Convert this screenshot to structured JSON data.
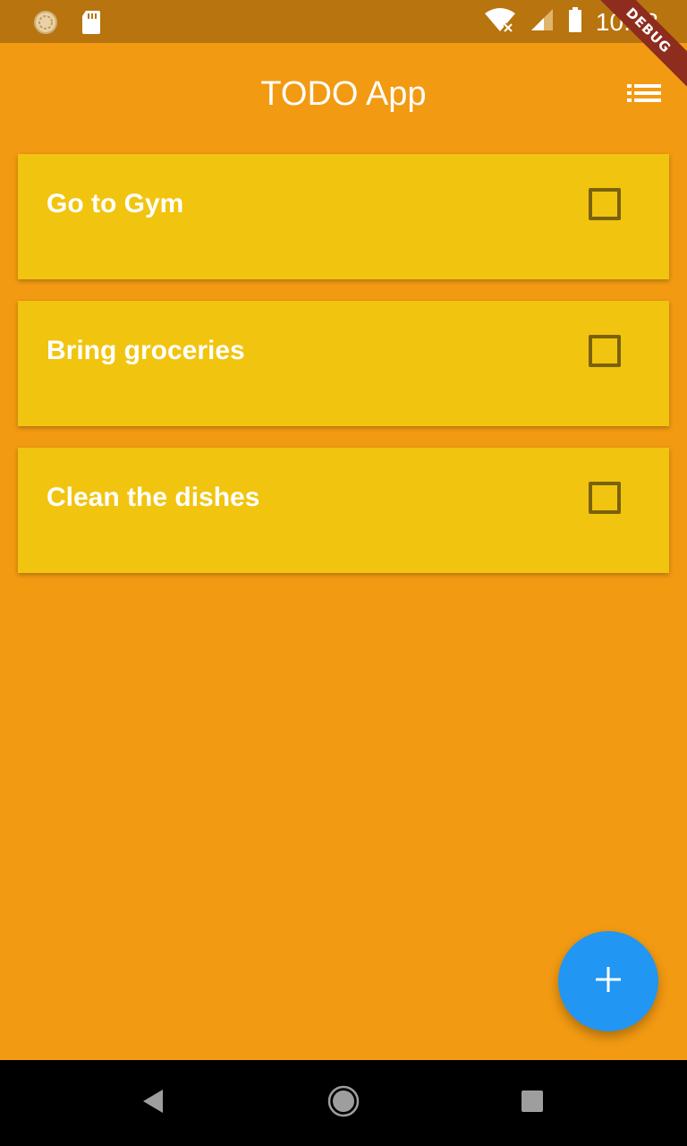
{
  "status_bar": {
    "time": "10:08",
    "icons": [
      "sync-icon",
      "sd-card-icon",
      "wifi-off-icon",
      "signal-icon",
      "battery-icon"
    ]
  },
  "debug_ribbon": {
    "label": "DEBUG"
  },
  "app_bar": {
    "title": "TODO App",
    "action_icon": "list-icon"
  },
  "todos": [
    {
      "title": "Go to Gym",
      "checked": false
    },
    {
      "title": "Bring groceries",
      "checked": false
    },
    {
      "title": "Clean the dishes",
      "checked": false
    }
  ],
  "fab": {
    "icon": "add-icon"
  },
  "nav_bar": {
    "buttons": [
      "back-icon",
      "home-icon",
      "recents-icon"
    ]
  },
  "colors": {
    "background": "#F29A12",
    "status_bar": "#B8740E",
    "card": "#F1C40F",
    "fab": "#2196F3",
    "debug_ribbon": "#8E2C1E"
  }
}
